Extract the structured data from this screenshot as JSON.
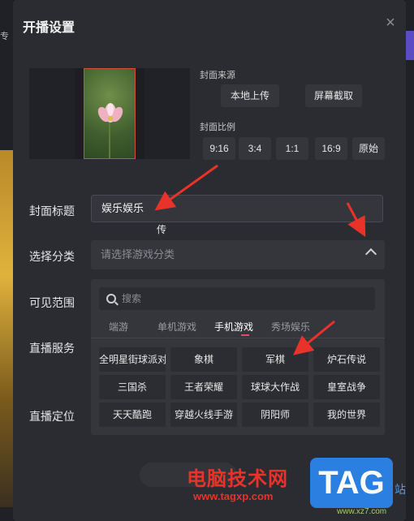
{
  "background": {
    "left_tab_text": "专"
  },
  "dialog": {
    "title": "开播设置",
    "close_glyph": "×"
  },
  "cover": {
    "reupload_label": "重新上传",
    "source_label": "封面来源",
    "source_buttons": [
      "本地上传",
      "屏幕截取"
    ],
    "ratio_label": "封面比例",
    "ratio_buttons": [
      "9:16",
      "3:4",
      "1:1",
      "16:9",
      "原始"
    ]
  },
  "form": {
    "title_label": "封面标题",
    "title_value": "娱乐娱乐",
    "category_label": "选择分类",
    "category_placeholder": "请选择游戏分类",
    "visibility_label": "可见范围",
    "service_label": "直播服务",
    "location_label": "直播定位"
  },
  "category_panel": {
    "search_placeholder": "搜索",
    "tabs": [
      "端游",
      "单机游戏",
      "手机游戏",
      "秀场娱乐"
    ],
    "active_tab": "手机游戏",
    "games": [
      "全明星街球派对",
      "象棋",
      "军棋",
      "炉石传说",
      "三国杀",
      "王者荣耀",
      "球球大作战",
      "皇室战争",
      "天天酷跑",
      "穿越火线手游",
      "阴阳师",
      "我的世界"
    ]
  },
  "watermark": {
    "site_name": "电脑技术网",
    "url": "www.tagxp.com",
    "logo": "TAG",
    "side_text": "站",
    "url2": "www.xz7.com"
  },
  "colors": {
    "dialog_bg": "#2b2c31",
    "control_bg": "#35363c",
    "accent_underline": "#e24a6f",
    "annotation_arrow": "#e8322a"
  }
}
